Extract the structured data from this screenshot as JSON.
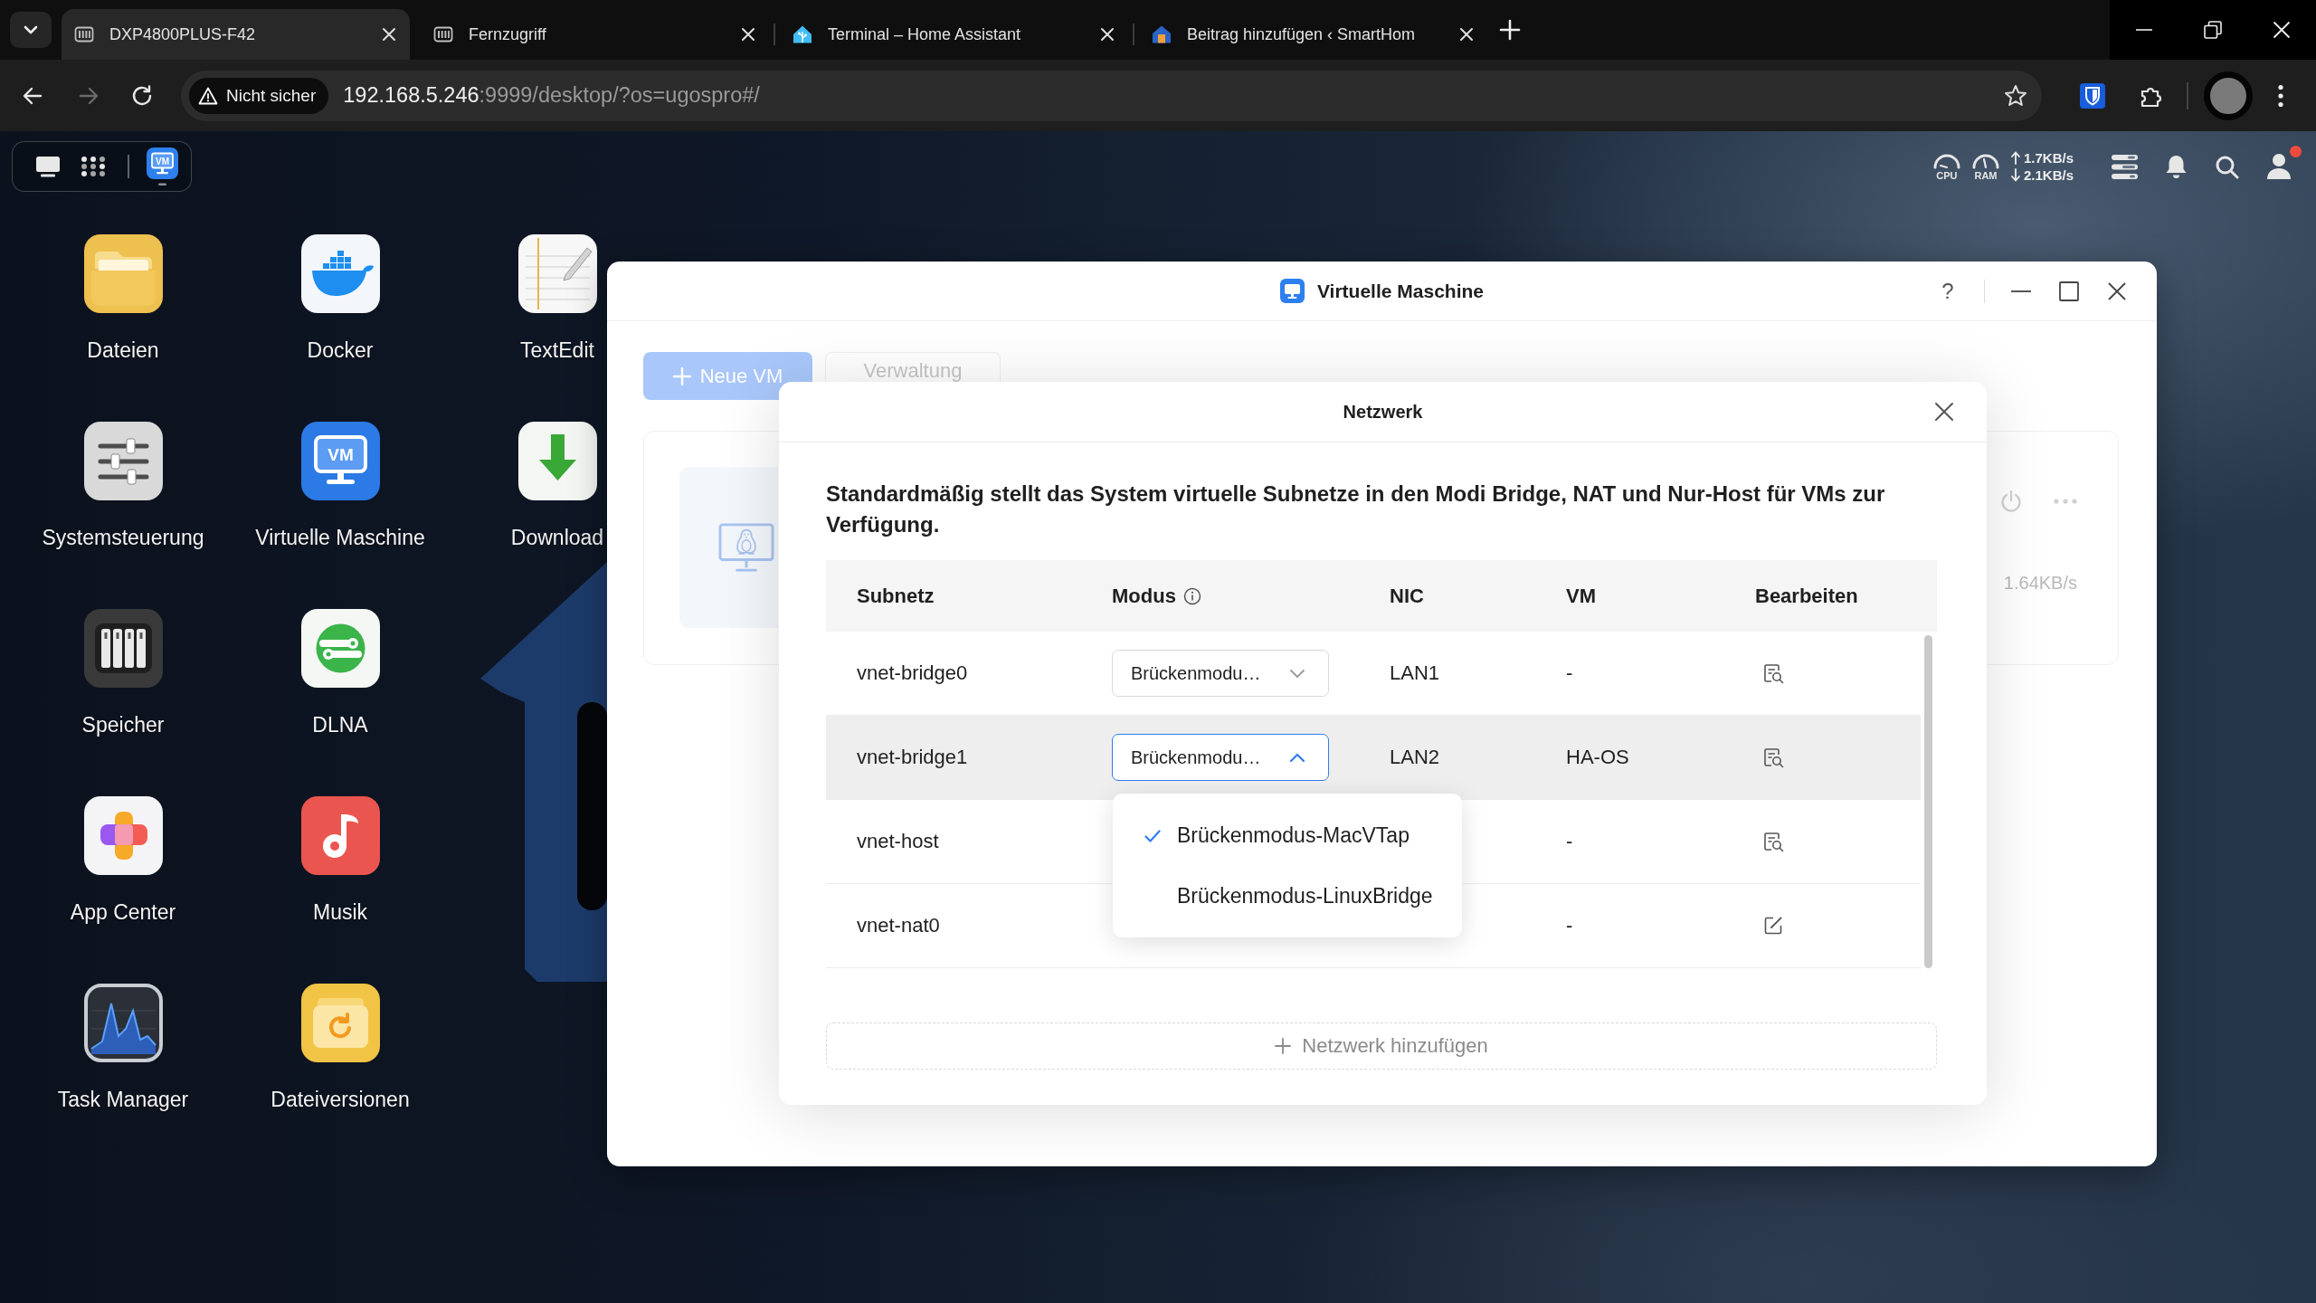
{
  "browser": {
    "tabs": [
      {
        "title": "DXP4800PLUS-F42",
        "selected": true
      },
      {
        "title": "Fernzugriff",
        "selected": false
      },
      {
        "title": "Terminal – Home Assistant",
        "selected": false
      },
      {
        "title": "Beitrag hinzufügen ‹ SmartHom",
        "selected": false
      }
    ],
    "forward_disabled": true,
    "address_bar": {
      "security_label": "Nicht sicher",
      "host": "192.168.5.246",
      "path": ":9999/desktop/?os=ugospro#/"
    }
  },
  "desktop": {
    "dock": {
      "app_badge": "VM"
    },
    "status": {
      "cpu_label": "CPU",
      "ram_label": "RAM",
      "upload": "1.7KB/s",
      "download": "2.1KB/s",
      "notification_dot": true
    },
    "apps": [
      {
        "label": "Dateien"
      },
      {
        "label": "Systemsteuerung"
      },
      {
        "label": "Speicher"
      },
      {
        "label": "App Center"
      },
      {
        "label": "Task Manager"
      },
      {
        "label": "Docker"
      },
      {
        "label": "Virtuelle Maschine",
        "badge": "VM"
      },
      {
        "label": "DLNA"
      },
      {
        "label": "Musik"
      },
      {
        "label": "Dateiversionen"
      },
      {
        "label": "TextEdit"
      },
      {
        "label": "Download"
      }
    ]
  },
  "vm_window": {
    "title": "Virtuelle Maschine",
    "help": "?",
    "new_vm_button": "Neue VM",
    "manage_button": "Verwaltung",
    "vm_card": {
      "speed": "1.64KB/s"
    },
    "network_dialog": {
      "title": "Netzwerk",
      "description": "Standardmäßig stellt das System virtuelle Subnetze in den Modi Bridge, NAT und Nur-Host für VMs zur Verfügung.",
      "columns": [
        {
          "label": "Subnetz",
          "info": false
        },
        {
          "label": "Modus",
          "info": true
        },
        {
          "label": "NIC",
          "info": false
        },
        {
          "label": "VM",
          "info": false
        },
        {
          "label": "Bearbeiten",
          "info": false
        }
      ],
      "rows": [
        {
          "subnet": "vnet-bridge0",
          "mode": {
            "value": "Brückenmodu…",
            "open": false
          },
          "nic": "LAN1",
          "vm": "-",
          "kind": "view",
          "highlighted": false
        },
        {
          "subnet": "vnet-bridge1",
          "mode": {
            "value": "Brückenmodu…",
            "open": true,
            "options": [
              {
                "label": "Brückenmodus-MacVTap",
                "selected": true
              },
              {
                "label": "Brückenmodus-LinuxBridge",
                "selected": false
              }
            ]
          },
          "nic": "LAN2",
          "vm": "HA-OS",
          "kind": "view",
          "highlighted": true
        },
        {
          "subnet": "vnet-host",
          "vm": "-",
          "kind": "view",
          "highlighted": false
        },
        {
          "subnet": "vnet-nat0",
          "vm": "-",
          "kind": "edit",
          "highlighted": false
        }
      ],
      "add_button": "Netzwerk hinzufügen"
    }
  }
}
